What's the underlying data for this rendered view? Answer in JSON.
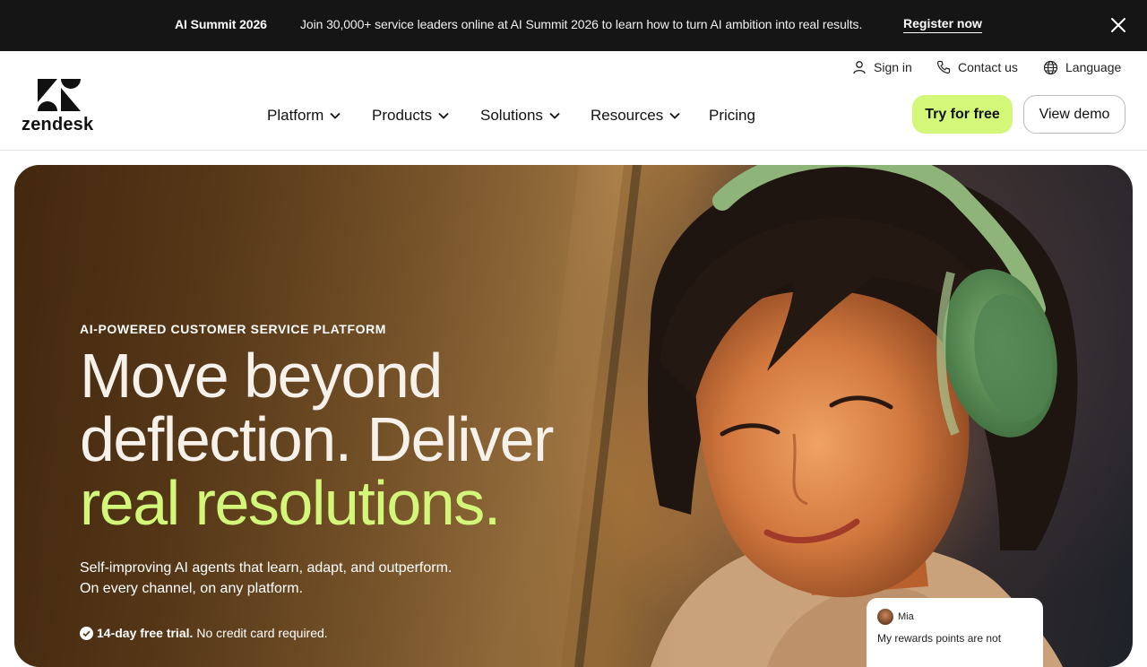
{
  "announcement": {
    "title": "AI Summit 2026",
    "message": "Join 30,000+ service leaders online at AI Summit 2026 to learn how to turn AI ambition into real results.",
    "cta": "Register now",
    "close_icon": "close-icon"
  },
  "brand": {
    "name": "zendesk",
    "icon": "zendesk-logo-icon"
  },
  "utility": {
    "sign_in": "Sign in",
    "contact": "Contact us",
    "language": "Language"
  },
  "nav": {
    "platform": "Platform",
    "products": "Products",
    "solutions": "Solutions",
    "resources": "Resources",
    "pricing": "Pricing"
  },
  "buttons": {
    "try": "Try for free",
    "demo": "View demo"
  },
  "hero": {
    "eyebrow": "AI-POWERED CUSTOMER SERVICE PLATFORM",
    "headline_line1": "Move beyond",
    "headline_line2": "deflection. Deliver",
    "headline_accent": "real resolutions.",
    "sub_line1": "Self-improving AI agents that learn, adapt, and outperform.",
    "sub_line2": "On every channel, on any platform.",
    "trial_bold": "14-day free trial.",
    "trial_rest": "No credit card required."
  },
  "chat": {
    "name": "Mia",
    "message": "My rewards points are not"
  },
  "colors": {
    "accent": "#d2f779",
    "announce_bg": "#151515"
  }
}
